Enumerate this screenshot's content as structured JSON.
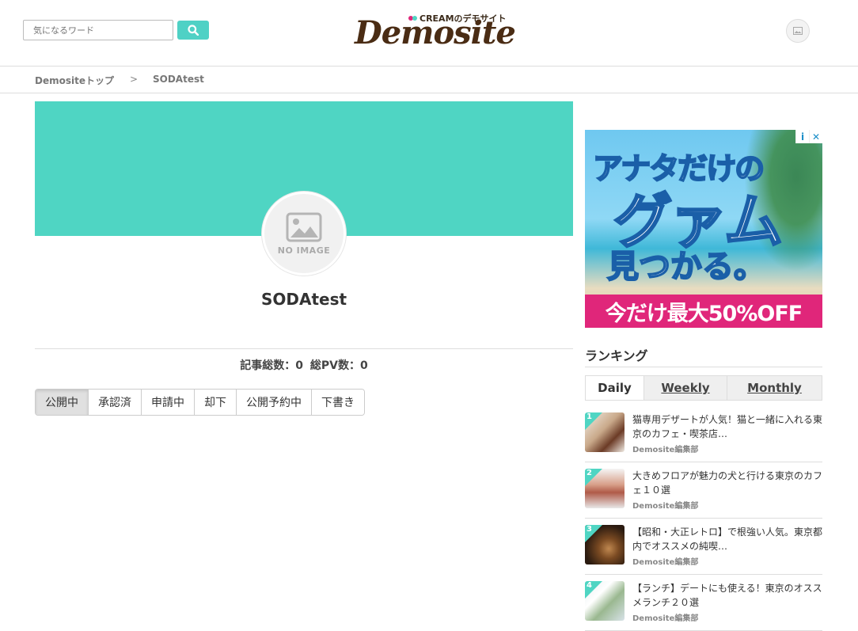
{
  "header": {
    "search_placeholder": "気になるワード",
    "logo_sub": "CREAMのデモサイト",
    "logo_main": "Demosite"
  },
  "breadcrumb": {
    "home": "Demositeトップ",
    "separator": ">",
    "current": "SODAtest"
  },
  "profile": {
    "no_image": "NO IMAGE",
    "name": "SODAtest",
    "stats_articles": "記事総数：0",
    "stats_pv": "総PV数：0",
    "tabs": [
      "公開中",
      "承認済",
      "申請中",
      "却下",
      "公開予約中",
      "下書き"
    ],
    "active_tab": "公開中"
  },
  "ad": {
    "line1": "アナタだけの",
    "line2": "グァム",
    "line3": "見つかる。",
    "banner": "今だけ最大50%OFF",
    "info_icon": "i",
    "close_icon": "✕"
  },
  "ranking": {
    "title": "ランキング",
    "tabs": [
      "Daily",
      "Weekly",
      "Monthly"
    ],
    "active_tab": "Daily",
    "items": [
      {
        "rank": "1",
        "title": "猫専用デザートが人気！猫と一緒に入れる東京のカフェ・喫茶店…",
        "author": "Demosite編集部"
      },
      {
        "rank": "2",
        "title": "大きめフロアが魅力の犬と行ける東京のカフェ１０選",
        "author": "Demosite編集部"
      },
      {
        "rank": "3",
        "title": "【昭和・大正レトロ】で根強い人気。東京都内でオススメの純喫…",
        "author": "Demosite編集部"
      },
      {
        "rank": "4",
        "title": "【ランチ】デートにも使える！東京のオススメランチ２０選",
        "author": "Demosite編集部"
      }
    ]
  },
  "colors": {
    "accent": "#4fd5c3",
    "ad_banner": "#e0267a"
  }
}
